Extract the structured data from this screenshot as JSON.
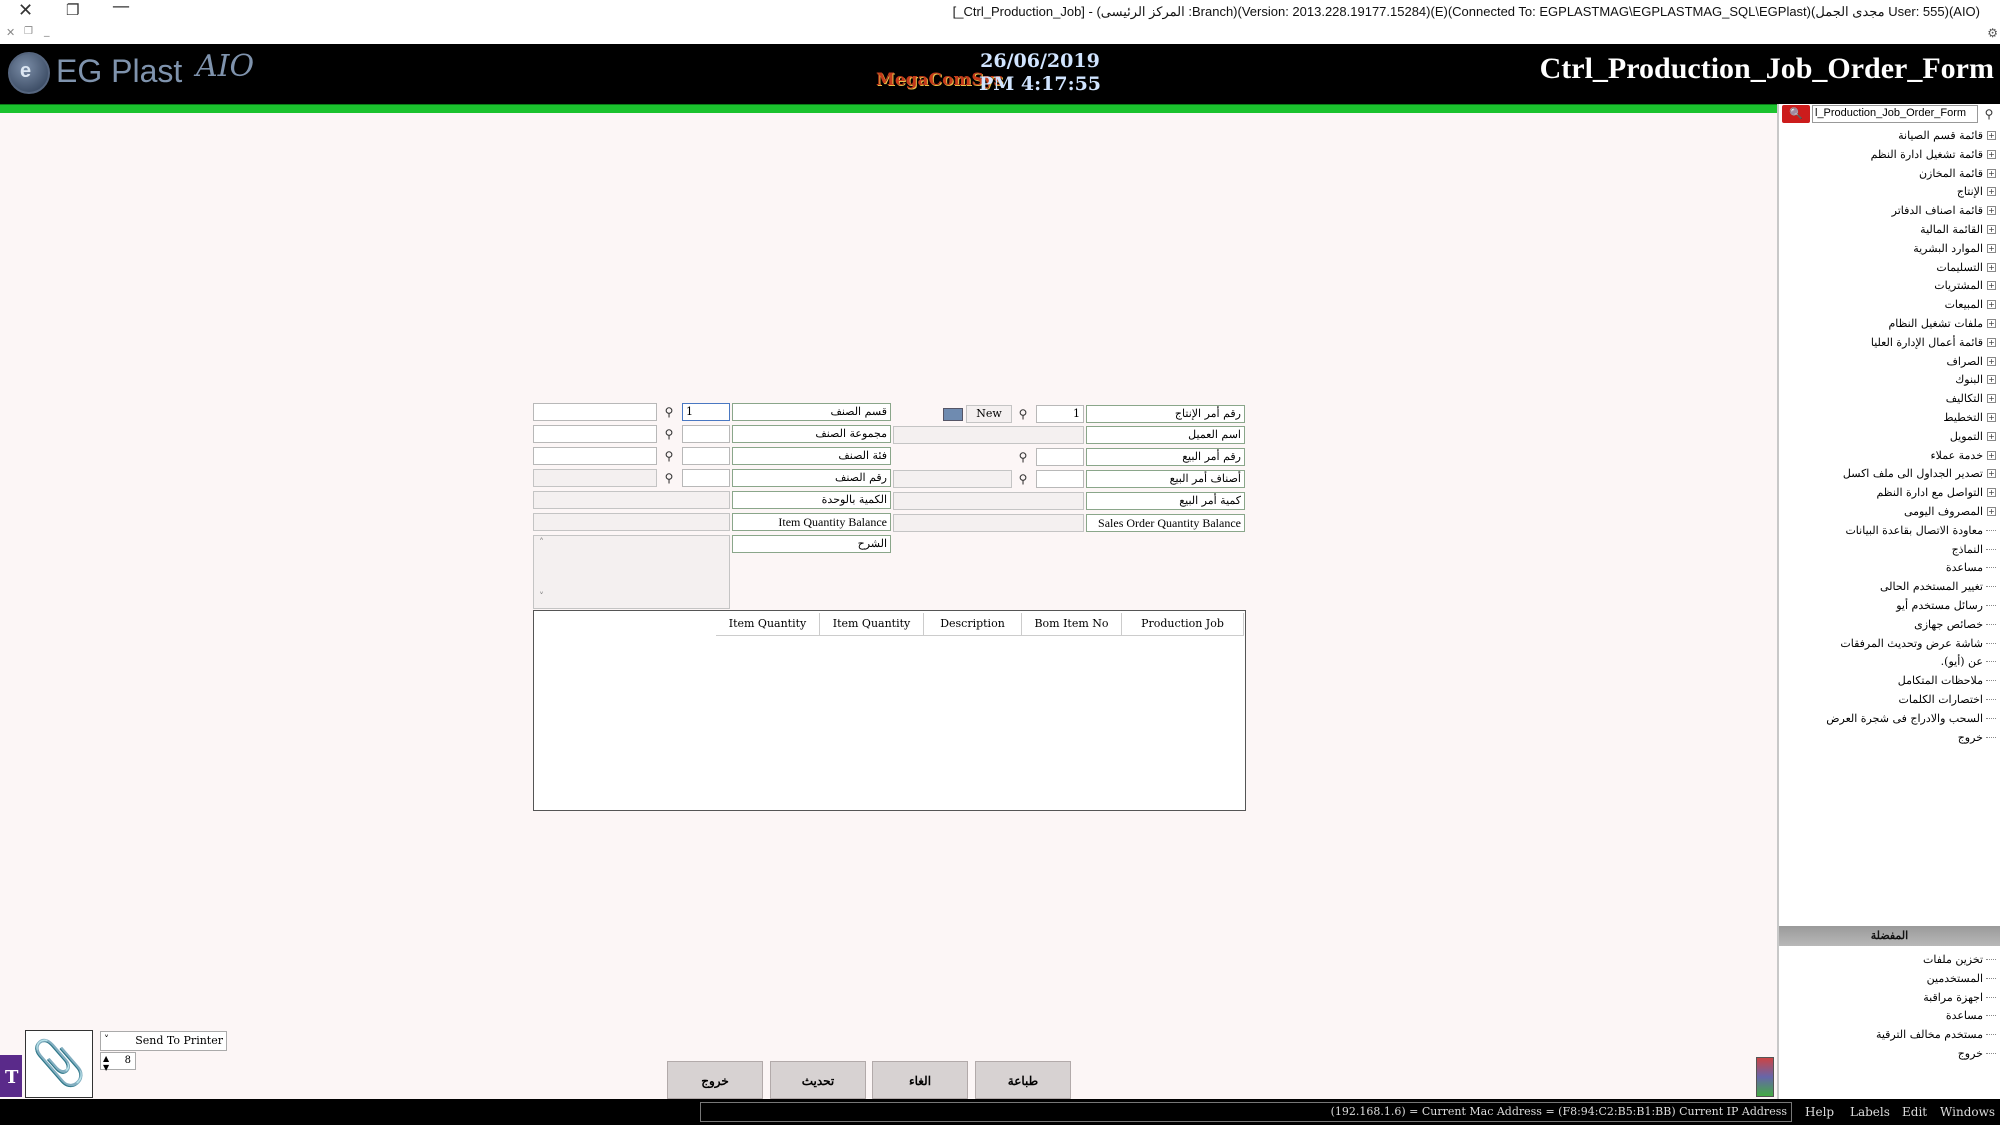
{
  "window": {
    "title": "[_Ctrl_Production_Job] - (المركز الرئيسى :Branch)(Version: 2013.228.19177.15284)(E)(Connected To: EGPLASTMAG\\EGPLASTMAG_SQL\\EGPlast)(مجدى الجمل User: 555)(AIO)"
  },
  "header": {
    "app_name": "EG Plast",
    "app_suffix": "AIO",
    "vendor_logo": "MegaComSys",
    "date": "26/06/2019",
    "time": "PM 4:17:55",
    "form_title": "Ctrl_Production_Job_Order_Form"
  },
  "sidebar": {
    "search_value": "l_Production_Job_Order_Form",
    "tree": [
      {
        "label": "قائمة قسم الصيانة",
        "expandable": true
      },
      {
        "label": "قائمة تشغيل ادارة النظم",
        "expandable": true
      },
      {
        "label": "قائمة المخازن",
        "expandable": true
      },
      {
        "label": "الإنتاج",
        "expandable": true
      },
      {
        "label": "قائمة اصناف الدفاتر",
        "expandable": true
      },
      {
        "label": "القائمة المالية",
        "expandable": true
      },
      {
        "label": "الموارد البشرية",
        "expandable": true
      },
      {
        "label": "التسليمات",
        "expandable": true
      },
      {
        "label": "المشتريات",
        "expandable": true
      },
      {
        "label": "المبيعات",
        "expandable": true
      },
      {
        "label": "ملفات تشغيل النظام",
        "expandable": true
      },
      {
        "label": "قائمة أعمال الإدارة العليا",
        "expandable": true
      },
      {
        "label": "الصراف",
        "expandable": true
      },
      {
        "label": "البنوك",
        "expandable": true
      },
      {
        "label": "التكاليف",
        "expandable": true
      },
      {
        "label": "التخطيط",
        "expandable": true
      },
      {
        "label": "التمويل",
        "expandable": true
      },
      {
        "label": "خدمة عملاء",
        "expandable": true
      },
      {
        "label": "تصدير الجداول الى ملف اكسل",
        "expandable": true
      },
      {
        "label": "التواصل مع ادارة النظم",
        "expandable": true
      },
      {
        "label": "المصروف اليومى",
        "expandable": true
      },
      {
        "label": "معاودة الاتصال بقاعدة البيانات",
        "expandable": false
      },
      {
        "label": "النماذج",
        "expandable": false
      },
      {
        "label": "مساعدة",
        "expandable": false
      },
      {
        "label": "تغيير المستخدم الحالى",
        "expandable": false
      },
      {
        "label": "رسائل مستخدم أيو",
        "expandable": false
      },
      {
        "label": "خصائص جهازى",
        "expandable": false
      },
      {
        "label": "شاشة عرض وتحديث المرفقات",
        "expandable": false
      },
      {
        "label": "عن (أيو).",
        "expandable": false
      },
      {
        "label": "ملاحظات المتكامل",
        "expandable": false
      },
      {
        "label": "اختصارات الكلمات",
        "expandable": false
      },
      {
        "label": "السحب والادراج فى شجرة العرض",
        "expandable": false
      },
      {
        "label": "خروج",
        "expandable": false
      }
    ],
    "favorites_title": "المفضلة",
    "favorites": [
      {
        "label": "تخزين ملفات"
      },
      {
        "label": "المستخدمين"
      },
      {
        "label": "اجهزة مراقبة"
      },
      {
        "label": "مساعدة"
      },
      {
        "label": "مستخدم مخالف الترقية"
      },
      {
        "label": "خروج"
      }
    ]
  },
  "form": {
    "job_no_label": "رقم أمر الإنتاج",
    "job_no_value": "1",
    "new_label": "New",
    "customer_label": "اسم العميل",
    "sales_order_label": "رقم أمر البيع",
    "sales_items_label": "أصناف أمر البيع",
    "sales_qty_label": "كمية أمر البيع",
    "sales_balance_label": "Sales Order Quantity Balance",
    "item_section_label": "قسم الصنف",
    "item_section_code": "1",
    "item_group_label": "مجموعة الصنف",
    "item_category_label": "فئة الصنف",
    "item_no_label": "رقم الصنف",
    "unit_qty_label": "الكمية بالوحدة",
    "item_balance_label": "Item Quantity Balance",
    "description_label": "الشرح"
  },
  "grid": {
    "columns": [
      "Production Job",
      "Bom Item No",
      "Description",
      "Item Quantity",
      "Item Quantity"
    ]
  },
  "buttons": {
    "print": "طباعة",
    "cancel": "الغاء",
    "refresh": "تحديث",
    "exit": "خروج"
  },
  "printer": {
    "option": "Send To Printer",
    "copies": "8"
  },
  "status": {
    "text": "(192.168.1.6) = Current Mac Address = (F8:94:C2:B5:B1:BB) Current IP Address",
    "menu": [
      "Help",
      "Labels",
      "Edit",
      "Windows"
    ]
  }
}
